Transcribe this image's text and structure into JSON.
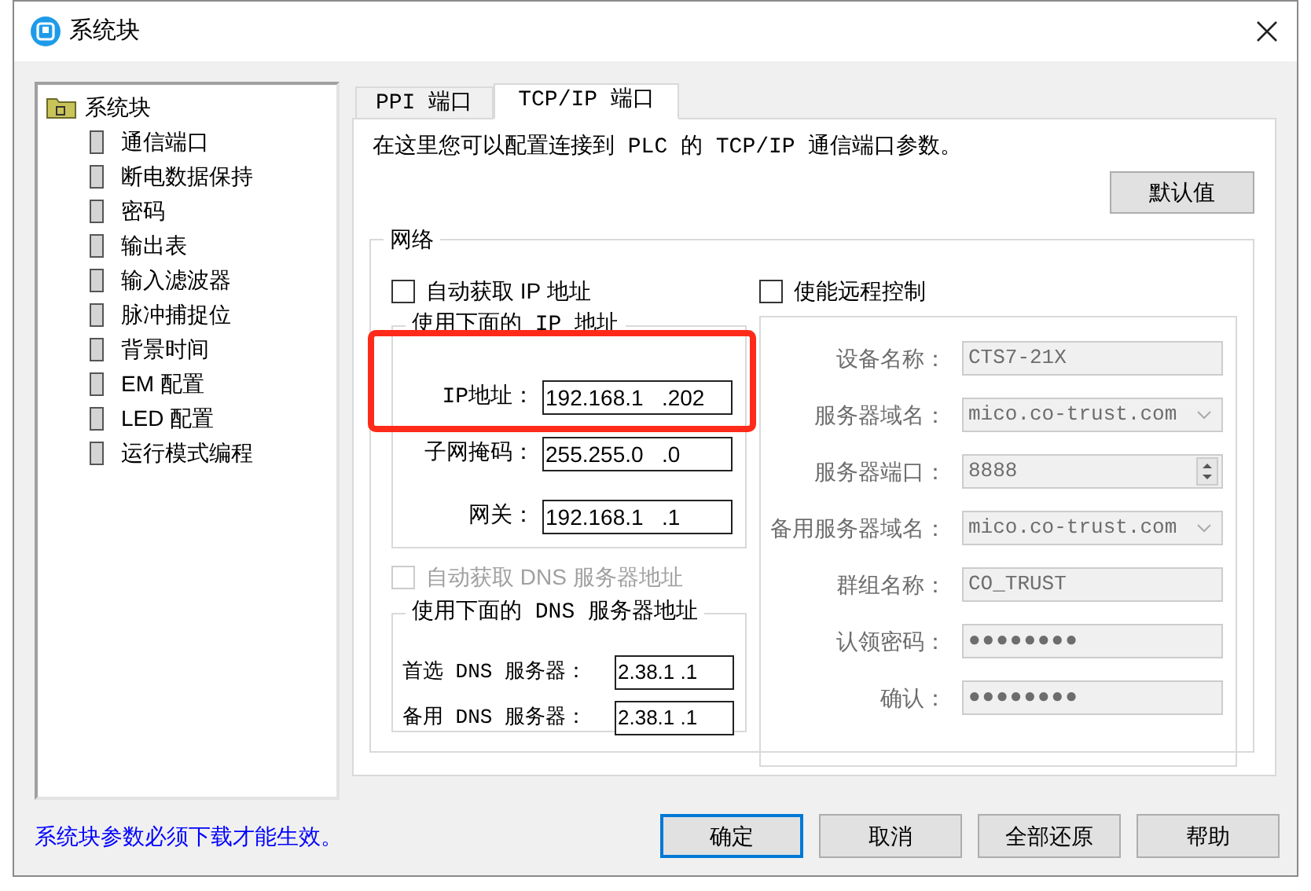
{
  "window": {
    "title": "系统块"
  },
  "tree": {
    "label": "系统块",
    "children": [
      {
        "label": "通信端口"
      },
      {
        "label": "断电数据保持"
      },
      {
        "label": "密码"
      },
      {
        "label": "输出表"
      },
      {
        "label": "输入滤波器"
      },
      {
        "label": "脉冲捕捉位"
      },
      {
        "label": "背景时间"
      },
      {
        "label": "EM 配置"
      },
      {
        "label": "LED 配置"
      },
      {
        "label": "运行模式编程"
      }
    ]
  },
  "tabs": [
    {
      "label": "PPI 端口",
      "selected": false
    },
    {
      "label": "TCP/IP 端口",
      "selected": true
    }
  ],
  "description": "在这里您可以配置连接到 PLC 的 TCP/IP 通信端口参数。",
  "default_button": "默认值",
  "network": {
    "title": "网络",
    "auto_ip": {
      "label": "自动获取 IP 地址",
      "checked": false
    },
    "static_ip": {
      "title": "使用下面的 IP 地址",
      "fields": [
        {
          "label": "IP地址：",
          "value": "192.168.1   .202",
          "highlighted": true
        },
        {
          "label": "子网掩码：",
          "value": "255.255.0   .0",
          "highlighted": false
        },
        {
          "label": "网关：",
          "value": "192.168.1   .1",
          "highlighted": false
        }
      ]
    },
    "auto_dns": {
      "label": "自动获取 DNS 服务器地址",
      "checked": false,
      "disabled": true
    },
    "static_dns": {
      "title": "使用下面的 DNS 服务器地址",
      "fields": [
        {
          "label": "首选 DNS 服务器：",
          "value": "2.38.1 .1"
        },
        {
          "label": "备用 DNS 服务器：",
          "value": "2.38.1 .1"
        }
      ]
    },
    "remote": {
      "label": "使能远程控制",
      "checked": false
    },
    "remote_fields": [
      {
        "kind": "text",
        "label": "设备名称：",
        "value": "CTS7-21X"
      },
      {
        "kind": "combo",
        "label": "服务器域名：",
        "value": "mico.co-trust.com"
      },
      {
        "kind": "spin",
        "label": "服务器端口：",
        "value": "8888"
      },
      {
        "kind": "combo",
        "label": "备用服务器域名：",
        "value": "mico.co-trust.com"
      },
      {
        "kind": "text",
        "label": "群组名称：",
        "value": "CO_TRUST"
      },
      {
        "kind": "password",
        "label": "认领密码：",
        "value": "●●●●●●●●"
      },
      {
        "kind": "password",
        "label": "确认：",
        "value": "●●●●●●●●"
      }
    ]
  },
  "footer_note": "系统块参数必须下载才能生效。",
  "buttons": [
    {
      "label": "确定",
      "focused": true
    },
    {
      "label": "取消",
      "focused": false
    },
    {
      "label": "全部还原",
      "focused": false
    },
    {
      "label": "帮助",
      "focused": false
    }
  ]
}
